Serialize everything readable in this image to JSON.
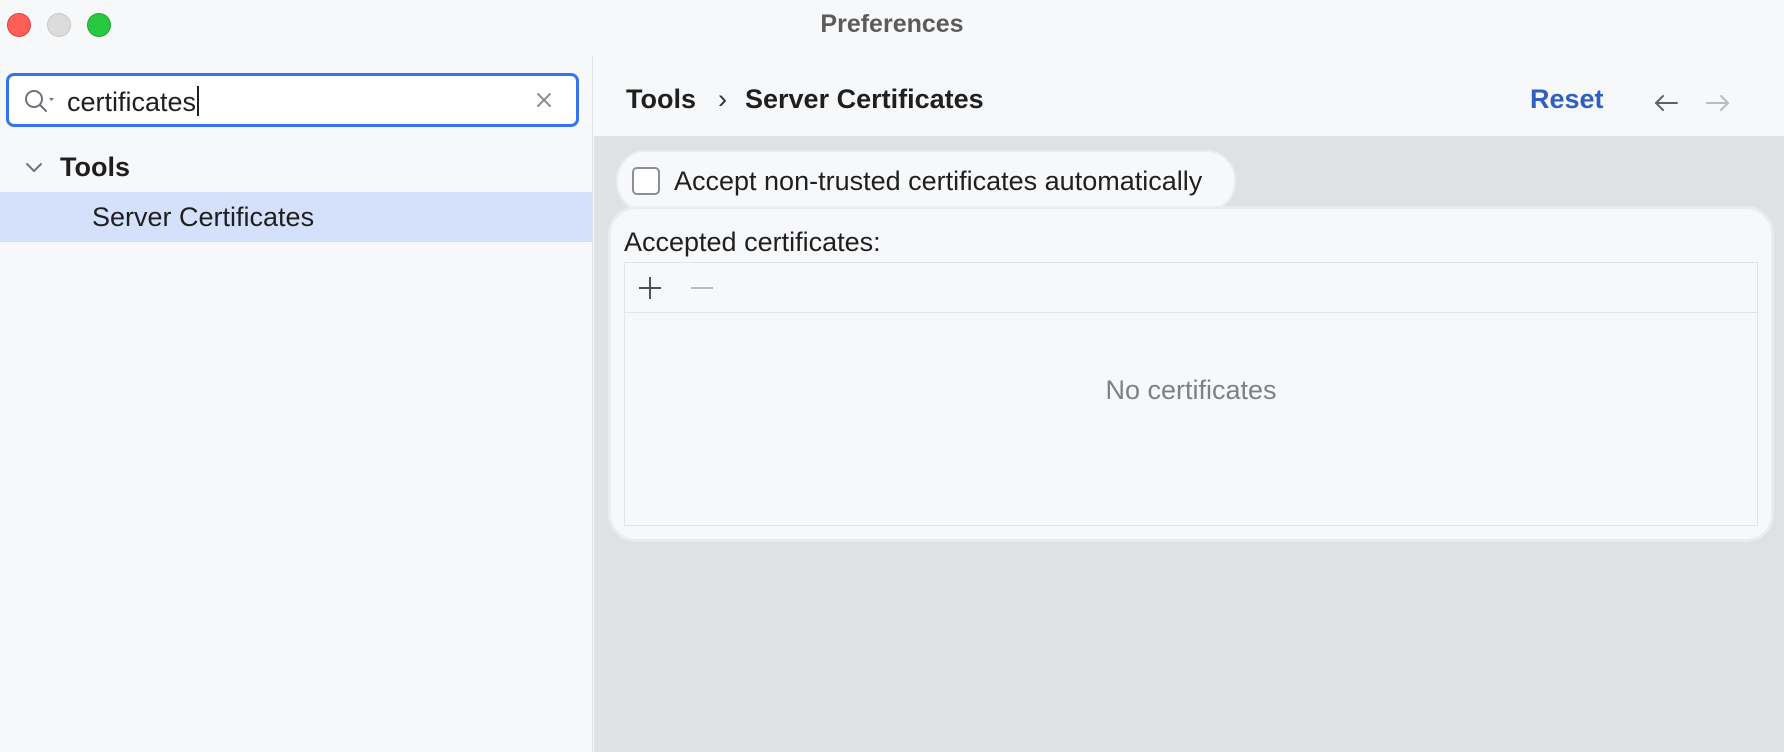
{
  "window": {
    "title": "Preferences"
  },
  "sidebar": {
    "search": {
      "value": "certificates",
      "icon": "search-icon",
      "clear_icon": "close-icon"
    },
    "tree": {
      "group_label": "Tools",
      "selected_item_label": "Server Certificates"
    }
  },
  "header": {
    "breadcrumb": {
      "parent": "Tools",
      "separator": "›",
      "current": "Server Certificates"
    },
    "reset_label": "Reset"
  },
  "settings": {
    "accept_untrusted_label": "Accept non-trusted certificates automatically",
    "accept_untrusted_checked": false,
    "accepted_certificates_label": "Accepted certificates:",
    "empty_state": "No certificates"
  },
  "colors": {
    "accent": "#3574f0",
    "link": "#2f5fbf",
    "selection": "#d5e1fb",
    "content_background": "#dfe1e5"
  }
}
